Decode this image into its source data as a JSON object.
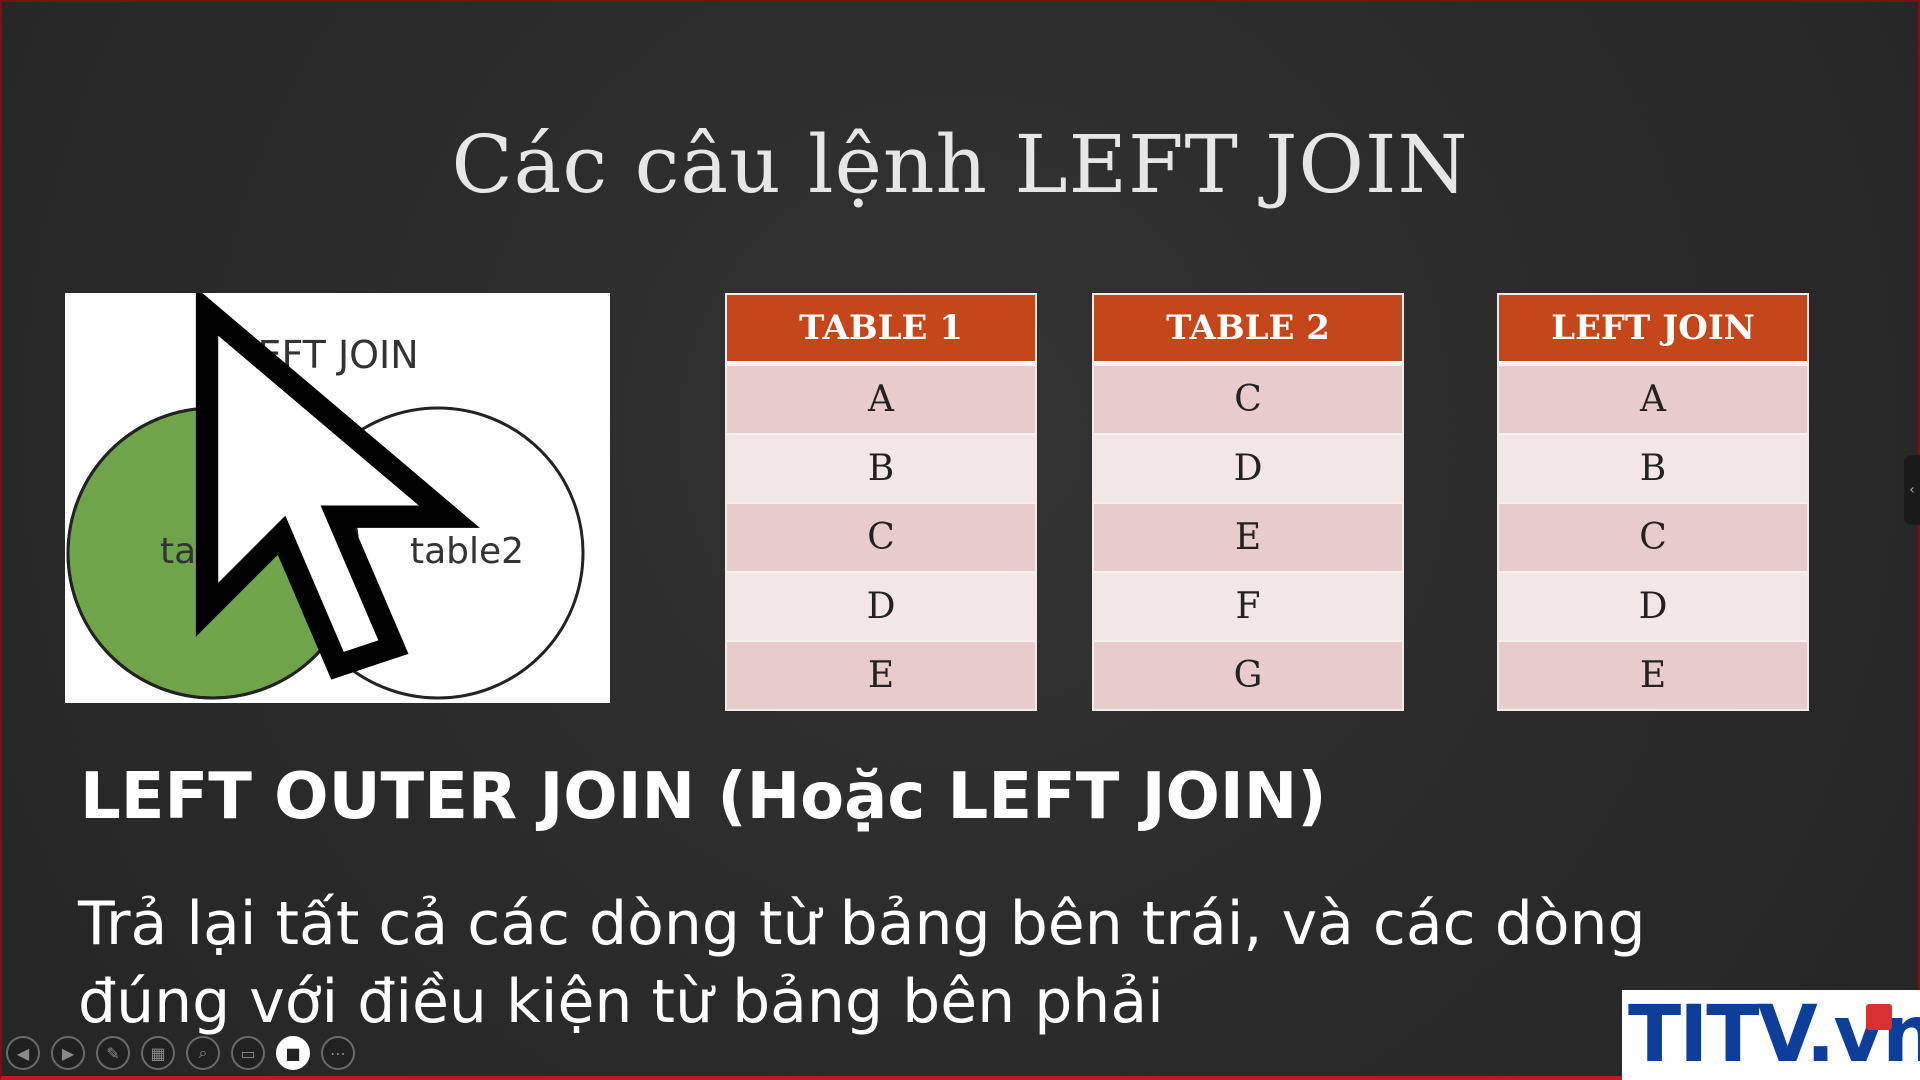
{
  "slide": {
    "title": "Các câu lệnh LEFT JOIN",
    "heading": "LEFT OUTER JOIN (Hoặc LEFT JOIN)",
    "description": "Trả lại tất cả các dòng từ bảng bên trái, và các dòng đúng với điều kiện từ bảng bên phải"
  },
  "venn": {
    "title": "LEFT JOIN",
    "left_label": "table1",
    "right_label": "table2",
    "left_fill": "#70a44a"
  },
  "tables": [
    {
      "header": "TABLE 1",
      "rows": [
        "A",
        "B",
        "C",
        "D",
        "E"
      ]
    },
    {
      "header": "TABLE 2",
      "rows": [
        "C",
        "D",
        "E",
        "F",
        "G"
      ]
    },
    {
      "header": "LEFT JOIN",
      "rows": [
        "A",
        "B",
        "C",
        "D",
        "E"
      ]
    }
  ],
  "colors": {
    "header_bg": "#c5461a",
    "row_dark": "#e8cccb",
    "row_light": "#f3e6e6"
  },
  "controls": [
    {
      "icon": "previous-icon",
      "glyph": "◀"
    },
    {
      "icon": "next-icon",
      "glyph": "▶"
    },
    {
      "icon": "pen-icon",
      "glyph": "✎"
    },
    {
      "icon": "slides-grid-icon",
      "glyph": "▦"
    },
    {
      "icon": "zoom-icon",
      "glyph": "⌕"
    },
    {
      "icon": "subtitles-icon",
      "glyph": "▭"
    },
    {
      "icon": "camera-icon",
      "glyph": "■"
    },
    {
      "icon": "more-icon",
      "glyph": "⋯"
    }
  ],
  "logo": {
    "text": "TITV.vn"
  },
  "side_tab": {
    "glyph": "‹"
  }
}
